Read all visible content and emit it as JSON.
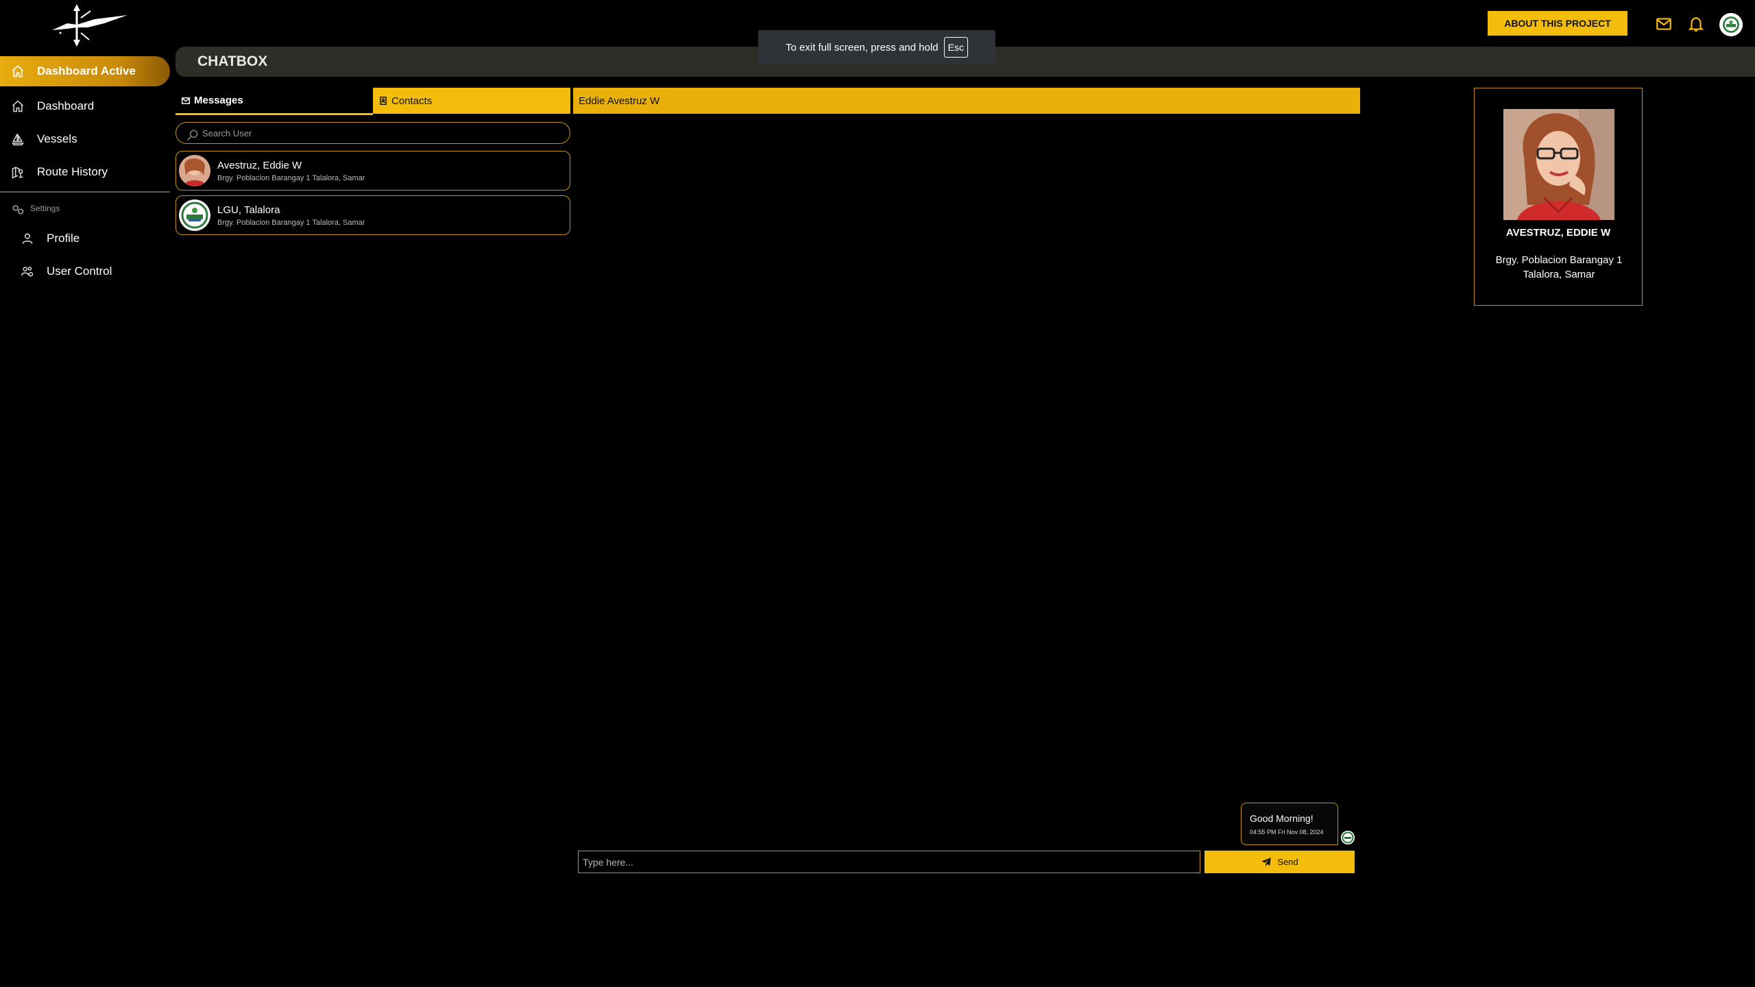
{
  "sidebar": {
    "active_item": {
      "label": "Dashboard Active",
      "icon": "home-icon"
    },
    "items": [
      {
        "label": "Dashboard",
        "icon": "home-icon"
      },
      {
        "label": "Vessels",
        "icon": "sailboat-icon"
      },
      {
        "label": "Route History",
        "icon": "map-pin-icon"
      }
    ],
    "settings_heading": "Settings",
    "settings_items": [
      {
        "label": "Profile",
        "icon": "user-icon"
      },
      {
        "label": "User Control",
        "icon": "users-cog-icon"
      }
    ]
  },
  "header": {
    "about_button": "ABOUT THIS PROJECT",
    "icons": [
      "mail-icon",
      "bell-icon",
      "avatar"
    ]
  },
  "fullscreen_notice": {
    "text": "To exit full screen, press and hold",
    "key": "Esc"
  },
  "page_title": "CHATBOX",
  "tabs": {
    "messages": "Messages",
    "contacts": "Contacts"
  },
  "search": {
    "placeholder": "Search User"
  },
  "contacts": [
    {
      "name": "Avestruz, Eddie W",
      "address": "Brgy. Poblacion Barangay 1 Talalora, Samar"
    },
    {
      "name": "LGU, Talalora",
      "address": "Brgy. Poblacion Barangay 1 Talalora, Samar"
    }
  ],
  "chat": {
    "recipient": "Eddie Avestruz W",
    "messages": [
      {
        "text": "Good Morning!",
        "time": "04:55 PM Fri Nov 08, 2024"
      }
    ],
    "input_placeholder": "Type here...",
    "send_label": "Send"
  },
  "profile": {
    "name": "AVESTRUZ, EDDIE W",
    "address": "Brgy. Poblacion Barangay 1 Talalora, Samar"
  },
  "colors": {
    "accent": "#f4bd0c",
    "border": "#c79410",
    "background": "#000000",
    "header_bar": "#2e2e28"
  }
}
